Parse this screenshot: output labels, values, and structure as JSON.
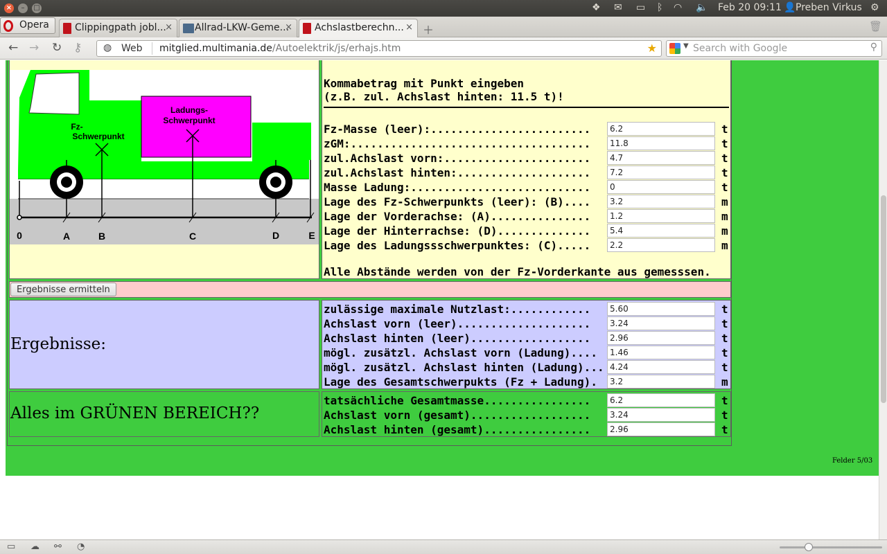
{
  "system": {
    "clock": "Feb 20 09:11",
    "user": "Preben Virkus"
  },
  "browser": {
    "menu_label": "Opera",
    "tabs": [
      {
        "label": "Clippingpath jobl..."
      },
      {
        "label": "Allrad-LKW-Geme..."
      },
      {
        "label": "Achslastberechn..."
      }
    ],
    "web_badge": "Web",
    "url_domain": "mitglied.multimania.de",
    "url_path": "/Autoelektrik/js/erhajs.htm",
    "search_placeholder": "Search with Google"
  },
  "diagram": {
    "fz_label_1": "Fz-",
    "fz_label_2": "Schwerpunkt",
    "load_label_1": "Ladungs-",
    "load_label_2": "Schwerpunkt",
    "axis_points": [
      "0",
      "A",
      "B",
      "C",
      "D",
      "E"
    ],
    "colors": {
      "truck": "#00ff00",
      "load": "#ff00ff",
      "ground": "#c8c8c8",
      "sky": "#ffffff"
    }
  },
  "form": {
    "hint_line1": "Kommabetrag mit Punkt eingeben",
    "hint_line2": "(z.B. zul. Achslast hinten: 11.5 t)!",
    "footer_note": "Alle Abstände werden von der Fz-Vorderkante aus gemesssen.",
    "fields": [
      {
        "label": "Fz-Masse (leer):........................",
        "value": "6.2",
        "unit": "t"
      },
      {
        "label": "zGM:....................................",
        "value": "11.8",
        "unit": "t"
      },
      {
        "label": "zul.Achslast vorn:......................",
        "value": "4.7",
        "unit": "t"
      },
      {
        "label": "zul.Achslast hinten:....................",
        "value": "7.2",
        "unit": "t"
      },
      {
        "label": "Masse Ladung:...........................",
        "value": "0",
        "unit": "t"
      },
      {
        "label": "Lage des Fz-Schwerpunkts (leer): (B)....",
        "value": "3.2",
        "unit": "m"
      },
      {
        "label": "Lage der Vorderachse: (A)...............",
        "value": "1.2",
        "unit": "m"
      },
      {
        "label": "Lage der Hinterrachse: (D)..............",
        "value": "5.4",
        "unit": "m"
      },
      {
        "label": "Lage des Ladungssschwerpunktes: (C).....",
        "value": "2.2",
        "unit": "m"
      }
    ]
  },
  "actions": {
    "calc_button": "Ergebnisse ermitteln"
  },
  "results": {
    "title": "Ergebnisse:",
    "fields": [
      {
        "label": "zulässige maximale Nutzlast:............",
        "value": "5.60",
        "unit": "t"
      },
      {
        "label": "Achslast vorn (leer)....................",
        "value": "3.24",
        "unit": "t"
      },
      {
        "label": "Achslast hinten (leer)..................",
        "value": "2.96",
        "unit": "t"
      },
      {
        "label": "mögl. zusätzl. Achslast vorn (Ladung)....",
        "value": "1.46",
        "unit": "t"
      },
      {
        "label": "mögl. zusätzl. Achslast hinten (Ladung)...",
        "value": "4.24",
        "unit": "t"
      },
      {
        "label": "Lage des Gesamtschwerpukts (Fz + Ladung).",
        "value": "3.2",
        "unit": "m"
      }
    ]
  },
  "check": {
    "title": "Alles im GRÜNEN BEREICH??",
    "fields": [
      {
        "label": "tatsächliche Gesamtmasse................",
        "value": "6.2",
        "unit": "t"
      },
      {
        "label": "Achslast vorn (gesamt)..................",
        "value": "3.24",
        "unit": "t"
      },
      {
        "label": "Achslast hinten (gesamt)................",
        "value": "2.96",
        "unit": "t"
      }
    ]
  },
  "page_footer": "Felder 5/03"
}
